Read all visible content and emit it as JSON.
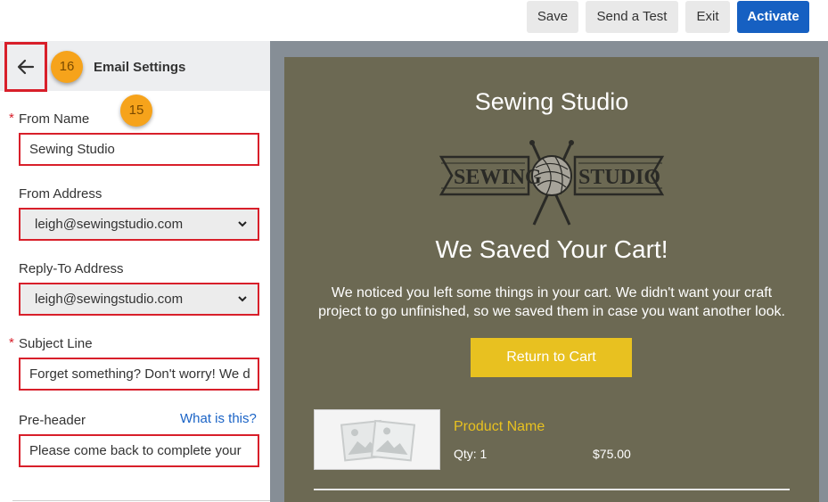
{
  "toolbar": {
    "save_label": "Save",
    "send_test_label": "Send a Test",
    "exit_label": "Exit",
    "activate_label": "Activate",
    "accent_color": "#1660c2"
  },
  "settings": {
    "title": "Email Settings",
    "back_icon": "arrow-left-icon",
    "badges": {
      "back": "16",
      "from_name": "15"
    },
    "highlight_color": "#d81f2a",
    "badge_color": "#f6a31b",
    "required_marker": "*",
    "from_name": {
      "label": "From Name",
      "value": "Sewing Studio"
    },
    "from_address": {
      "label": "From Address",
      "value": "leigh@sewingstudio.com"
    },
    "reply_to": {
      "label": "Reply-To Address",
      "value": "leigh@sewingstudio.com"
    },
    "subject": {
      "label": "Subject Line",
      "value": "Forget something? Don't worry! We d"
    },
    "preheader": {
      "label": "Pre-header",
      "help_link": "What is this?",
      "value": "Please come back to complete your"
    }
  },
  "preview": {
    "brand_title": "Sewing Studio",
    "logo_text_left": "SEWING",
    "logo_text_right": "STUDIO",
    "headline": "We Saved Your Cart!",
    "body": "We noticed you left some things in your cart. We didn't want your craft project to go unfinished, so we saved them in case you want another look.",
    "cta_label": "Return to Cart",
    "cta_color": "#e8c120",
    "background_color": "#6c6953",
    "product": {
      "name": "Product Name",
      "qty": "Qty: 1",
      "price": "$75.00",
      "image_icon": "image-placeholder-icon"
    }
  }
}
